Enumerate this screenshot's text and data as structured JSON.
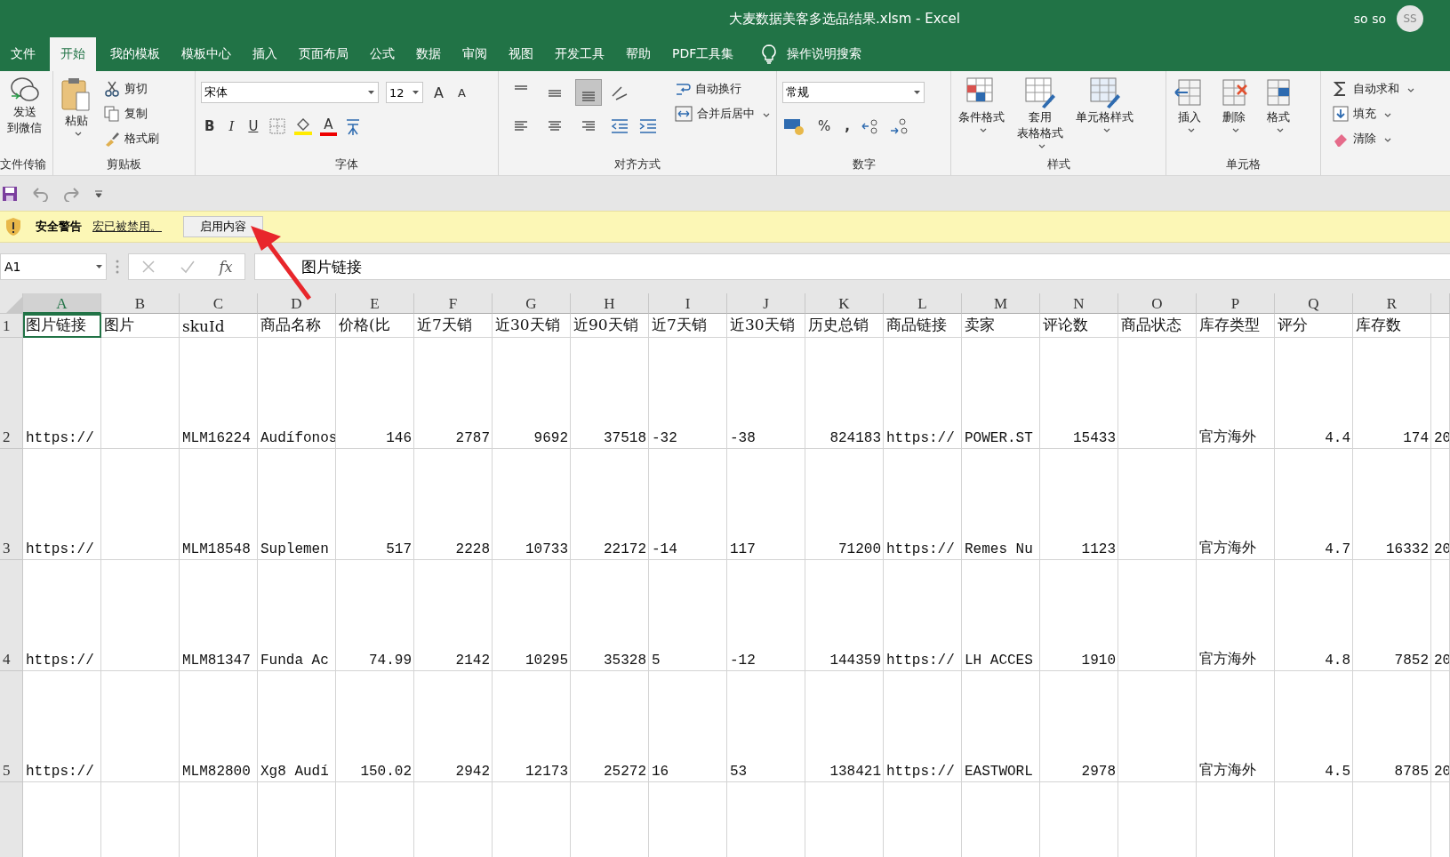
{
  "window": {
    "title": "大麦数据美客多选品结果.xlsm  -  Excel",
    "user": "so so",
    "avatar": "SS"
  },
  "tabs": [
    {
      "label": "文件",
      "selected": false
    },
    {
      "label": "开始",
      "selected": true
    },
    {
      "label": "我的模板",
      "selected": false
    },
    {
      "label": "模板中心",
      "selected": false
    },
    {
      "label": "插入",
      "selected": false
    },
    {
      "label": "页面布局",
      "selected": false
    },
    {
      "label": "公式",
      "selected": false
    },
    {
      "label": "数据",
      "selected": false
    },
    {
      "label": "审阅",
      "selected": false
    },
    {
      "label": "视图",
      "selected": false
    },
    {
      "label": "开发工具",
      "selected": false
    },
    {
      "label": "帮助",
      "selected": false
    },
    {
      "label": "PDF工具集",
      "selected": false
    }
  ],
  "tell_me": "操作说明搜索",
  "ribbon": {
    "transfer": {
      "label": "文件传输",
      "send": [
        "发送",
        "到微信"
      ]
    },
    "clipboard": {
      "label": "剪贴板",
      "paste": "粘贴",
      "commands": [
        "剪切",
        "复制",
        "格式刷"
      ]
    },
    "font": {
      "label": "字体",
      "font_name": "宋体",
      "font_size": "12",
      "grow": "A",
      "shrink": "A",
      "bold": "B",
      "italic": "I",
      "underline": "U",
      "font_color": "A"
    },
    "alignment": {
      "label": "对齐方式",
      "vertical": [
        {
          "selected": false
        },
        {
          "selected": false
        },
        {
          "selected": true
        }
      ],
      "wrap": "自动换行",
      "merge": "合并后居中"
    },
    "number": {
      "label": "数字",
      "format": "常规",
      "percent": "%",
      "comma": ","
    },
    "styles": {
      "label": "样式",
      "commands": [
        [
          "条件格式"
        ],
        [
          "套用",
          "表格格式"
        ],
        [
          "单元格样式"
        ]
      ]
    },
    "cells": {
      "label": "单元格",
      "commands": [
        "插入",
        "删除",
        "格式"
      ]
    },
    "editing": {
      "commands": [
        "自动求和",
        "填充",
        "清除"
      ]
    }
  },
  "security_bar": {
    "title": "安全警告",
    "message": "宏已被禁用。",
    "button": "启用内容"
  },
  "formula_bar": {
    "name_box": "A1",
    "fx": "fx",
    "formula": "图片链接"
  },
  "sheet": {
    "columns": [
      {
        "letter": "A",
        "selected": true,
        "numeric": false
      },
      {
        "letter": "B",
        "selected": false
      },
      {
        "letter": "C",
        "selected": false,
        "numeric": false
      },
      {
        "letter": "D",
        "selected": false,
        "numeric": false
      },
      {
        "letter": "E",
        "selected": false,
        "numeric": true
      },
      {
        "letter": "F",
        "selected": false,
        "numeric": true
      },
      {
        "letter": "G",
        "selected": false,
        "numeric": true
      },
      {
        "letter": "H",
        "selected": false,
        "numeric": true
      },
      {
        "letter": "I",
        "selected": false,
        "numeric": false
      },
      {
        "letter": "J",
        "selected": false,
        "numeric": false
      },
      {
        "letter": "K",
        "selected": false,
        "numeric": true
      },
      {
        "letter": "L",
        "selected": false,
        "numeric": false
      },
      {
        "letter": "M",
        "selected": false,
        "numeric": false
      },
      {
        "letter": "N",
        "selected": false,
        "numeric": true
      },
      {
        "letter": "O",
        "selected": false
      },
      {
        "letter": "P",
        "selected": false,
        "numeric": false
      },
      {
        "letter": "Q",
        "selected": false,
        "numeric": true
      },
      {
        "letter": "R",
        "selected": false,
        "numeric": true
      }
    ],
    "header_row": {
      "number": "1",
      "cells": [
        "图片链接",
        "图片",
        "skuId",
        "商品名称",
        "价格(比",
        "近7天销",
        "近30天销",
        "近90天销",
        "近7天销",
        "近30天销",
        "历史总销",
        "商品链接",
        "卖家",
        "评论数",
        "商品状态",
        "库存类型",
        "评分",
        "库存数"
      ]
    },
    "rows": [
      {
        "number": "2",
        "cells": [
          "https://",
          null,
          "MLM16224",
          "Audífonos",
          "146",
          "2787",
          "9692",
          "37518",
          "-32",
          "-38",
          "824183",
          "https://",
          "POWER.ST",
          "15433",
          null,
          "官方海外",
          "4.4",
          "174",
          "20"
        ]
      },
      {
        "number": "3",
        "cells": [
          "https://",
          null,
          "MLM18548",
          "Suplemen",
          "517",
          "2228",
          "10733",
          "22172",
          "-14",
          "117",
          "71200",
          "https://",
          "Remes Nu",
          "1123",
          null,
          "官方海外",
          "4.7",
          "16332",
          "20"
        ]
      },
      {
        "number": "4",
        "cells": [
          "https://",
          null,
          "MLM81347",
          "Funda Ac",
          "74.99",
          "2142",
          "10295",
          "35328",
          "5",
          "-12",
          "144359",
          "https://",
          "LH ACCES",
          "1910",
          null,
          "官方海外",
          "4.8",
          "7852",
          "20"
        ]
      },
      {
        "number": "5",
        "cells": [
          "https://",
          null,
          "MLM82800",
          "Xg8 Audí",
          "150.02",
          "2942",
          "12173",
          "25272",
          "16",
          "53",
          "138421",
          "https://",
          "EASTWORL",
          "2978",
          null,
          "官方海外",
          "4.5",
          "8785",
          "20"
        ]
      }
    ]
  }
}
